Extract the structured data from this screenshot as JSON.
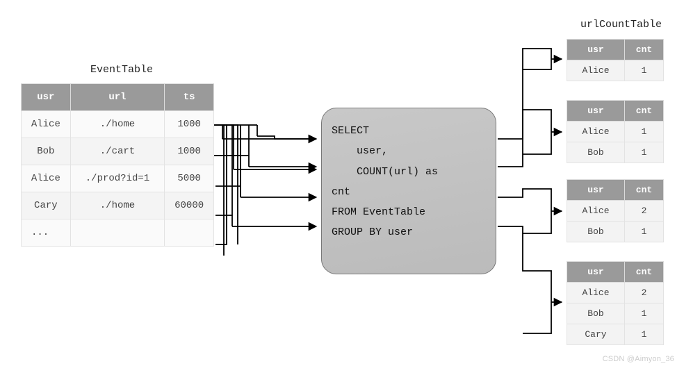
{
  "left": {
    "title": "EventTable",
    "headers": [
      "usr",
      "url",
      "ts"
    ],
    "rows": [
      [
        "Alice",
        "./home",
        "1000"
      ],
      [
        "Bob",
        "./cart",
        "1000"
      ],
      [
        "Alice",
        "./prod?id=1",
        "5000"
      ],
      [
        "Cary",
        "./home",
        "60000"
      ],
      [
        "...",
        "",
        ""
      ]
    ]
  },
  "query": {
    "lines": [
      "SELECT",
      "    user,",
      "    COUNT(url) as",
      "cnt",
      "FROM EventTable",
      "GROUP BY user"
    ]
  },
  "right": {
    "title": "urlCountTable",
    "headers": [
      "usr",
      "cnt"
    ],
    "tables": [
      [
        [
          "Alice",
          "1"
        ]
      ],
      [
        [
          "Alice",
          "1"
        ],
        [
          "Bob",
          "1"
        ]
      ],
      [
        [
          "Alice",
          "2"
        ],
        [
          "Bob",
          "1"
        ]
      ],
      [
        [
          "Alice",
          "2"
        ],
        [
          "Bob",
          "1"
        ],
        [
          "Cary",
          "1"
        ]
      ]
    ]
  },
  "watermark": "CSDN @Aimyon_36",
  "chart_data": {
    "type": "table",
    "title": "SQL aggregation from EventTable to urlCountTable",
    "input_table": {
      "columns": [
        "usr",
        "url",
        "ts"
      ],
      "rows": [
        [
          "Alice",
          "./home",
          1000
        ],
        [
          "Bob",
          "./cart",
          1000
        ],
        [
          "Alice",
          "./prod?id=1",
          5000
        ],
        [
          "Cary",
          "./home",
          60000
        ]
      ]
    },
    "sql": "SELECT user, COUNT(url) as cnt FROM EventTable GROUP BY user",
    "output_snapshots": [
      {
        "Alice": 1
      },
      {
        "Alice": 1,
        "Bob": 1
      },
      {
        "Alice": 2,
        "Bob": 1
      },
      {
        "Alice": 2,
        "Bob": 1,
        "Cary": 1
      }
    ]
  }
}
